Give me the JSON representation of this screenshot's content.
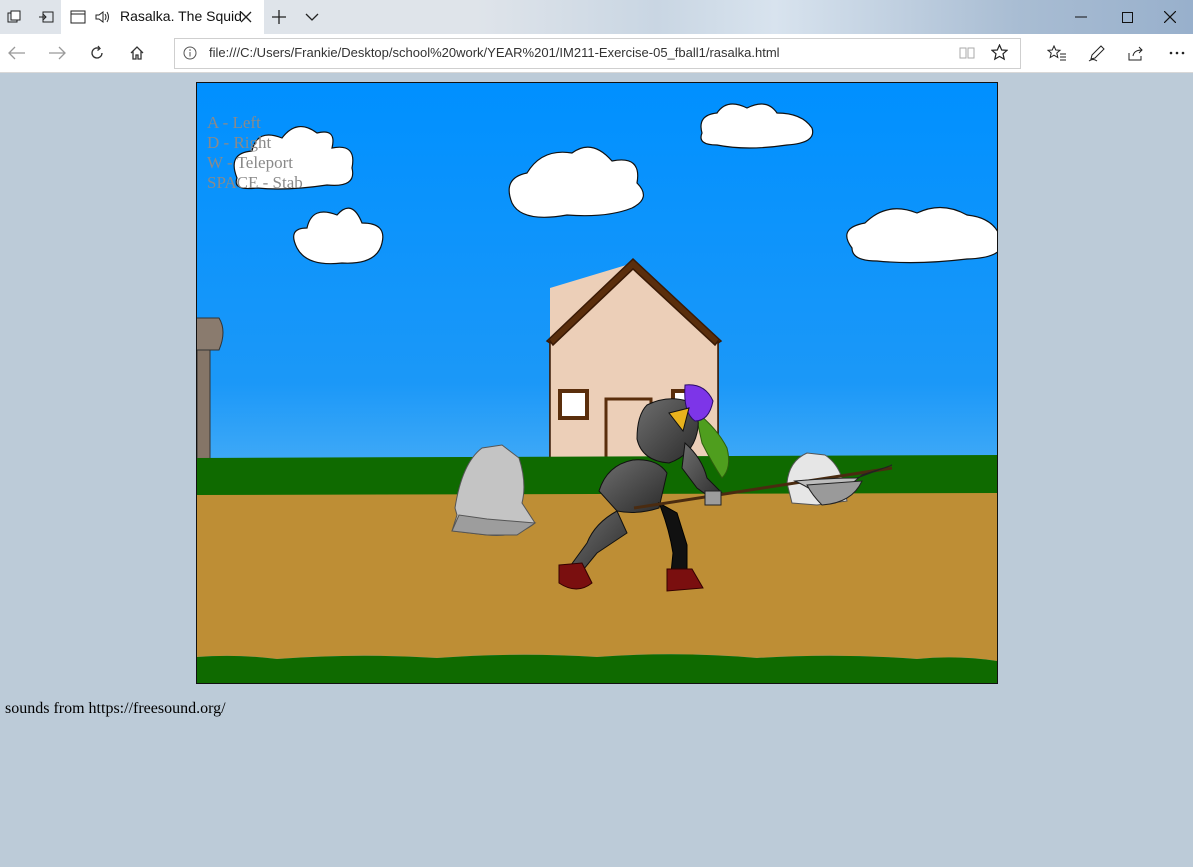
{
  "browser": {
    "tab_title": "Rasalka. The Squid",
    "address": "file:///C:/Users/Frankie/Desktop/school%20work/YEAR%201/IM211-Exercise-05_fball1/rasalka.html",
    "icons": [
      "tab-set-aside-icon",
      "tab-preview-icon",
      "page-icon",
      "audio-icon",
      "close-tab-icon",
      "new-tab-icon",
      "tab-list-icon",
      "minimize-icon",
      "maximize-icon",
      "close-window-icon",
      "back-icon",
      "forward-icon",
      "refresh-icon",
      "home-icon",
      "info-icon",
      "reading-view-icon",
      "favorite-star-icon",
      "favorites-icon",
      "pen-icon",
      "share-icon",
      "more-icon"
    ]
  },
  "game": {
    "controls": [
      "A - Left",
      "D - Right",
      "W - Teleport",
      "SPACE - Stab"
    ]
  },
  "footer": {
    "text": "sounds from https://freesound.org/"
  },
  "colors": {
    "sky_top": "#0090ff",
    "sky_bottom": "#5fb8f5",
    "grass": "#0f6a00",
    "dirt": "#be8e35",
    "house": "#eccfb8",
    "roof": "#5a2e0c",
    "page_bg": "#bccbd8"
  }
}
